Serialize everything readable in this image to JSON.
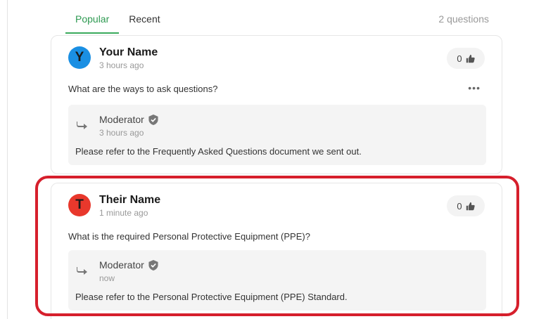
{
  "tabs": [
    {
      "label": "Popular",
      "active": true
    },
    {
      "label": "Recent",
      "active": false
    }
  ],
  "question_count": "2 questions",
  "questions": [
    {
      "avatar_letter": "Y",
      "avatar_color": "#1a8fe3",
      "author": "Your Name",
      "time": "3 hours ago",
      "likes": "0",
      "text": "What are the ways to ask questions?",
      "more": "•••",
      "reply": {
        "author": "Moderator",
        "time": "3 hours ago",
        "text": "Please refer to the Frequently Asked Questions document we sent out."
      }
    },
    {
      "avatar_letter": "T",
      "avatar_color": "#e8382c",
      "author": "Their Name",
      "time": "1 minute ago",
      "likes": "0",
      "text": "What is the required Personal Protective Equipment (PPE)?",
      "reply": {
        "author": "Moderator",
        "time": "now",
        "text": "Please refer to the Personal Protective Equipment (PPE) Standard."
      }
    }
  ],
  "icons": {
    "like": "thumbs-up-icon",
    "verified": "shield-check-icon",
    "reply": "reply-arrow-icon"
  },
  "colors": {
    "accent": "#3aaa5c",
    "highlight": "#d61f2c"
  }
}
